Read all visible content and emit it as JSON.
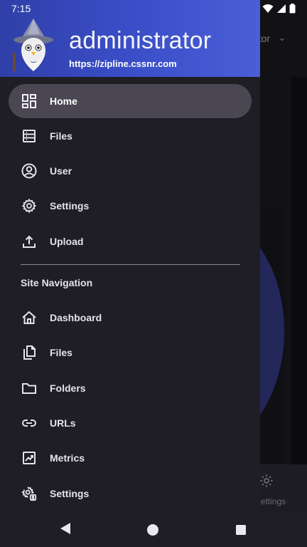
{
  "status_bar": {
    "time": "7:15"
  },
  "drawer": {
    "user_name": "administrator",
    "server_url": "https://zipline.cssnr.com",
    "items": [
      {
        "label": "Home",
        "icon": "dashboard-icon",
        "active": true
      },
      {
        "label": "Files",
        "icon": "list-icon"
      },
      {
        "label": "User",
        "icon": "account-icon"
      },
      {
        "label": "Settings",
        "icon": "gear-icon"
      },
      {
        "label": "Upload",
        "icon": "upload-icon"
      }
    ],
    "section_title": "Site Navigation",
    "site_items": [
      {
        "label": "Dashboard",
        "icon": "house-icon"
      },
      {
        "label": "Files",
        "icon": "files-icon"
      },
      {
        "label": "Folders",
        "icon": "folder-icon"
      },
      {
        "label": "URLs",
        "icon": "link-icon"
      },
      {
        "label": "Metrics",
        "icon": "chart-icon"
      },
      {
        "label": "Settings",
        "icon": "user-settings-icon"
      }
    ]
  },
  "background_app": {
    "header_text": "tor",
    "bottom_settings_label": "ettings"
  }
}
